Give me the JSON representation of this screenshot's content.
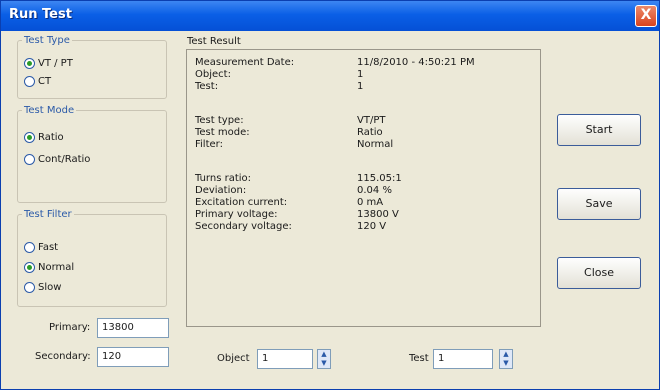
{
  "window": {
    "title": "Run Test",
    "close_glyph": "X"
  },
  "test_type": {
    "legend": "Test Type",
    "options": [
      "VT / PT",
      "CT"
    ],
    "selected": "VT / PT"
  },
  "test_mode": {
    "legend": "Test Mode",
    "options": [
      "Ratio",
      "Cont/Ratio"
    ],
    "selected": "Ratio"
  },
  "test_filter": {
    "legend": "Test Filter",
    "options": [
      "Fast",
      "Normal",
      "Slow"
    ],
    "selected": "Normal"
  },
  "result": {
    "label": "Test Result",
    "rows": [
      {
        "key": "Measurement Date:",
        "value": "11/8/2010 - 4:50:21 PM"
      },
      {
        "key": "Object:",
        "value": "1"
      },
      {
        "key": "Test:",
        "value": "1"
      },
      {
        "key": "Test type:",
        "value": "VT/PT"
      },
      {
        "key": "Test mode:",
        "value": "Ratio"
      },
      {
        "key": "Filter:",
        "value": "Normal"
      },
      {
        "key": "Turns ratio:",
        "value": "115.05:1"
      },
      {
        "key": "Deviation:",
        "value": "0.04 %"
      },
      {
        "key": "Excitation current:",
        "value": "0 mA"
      },
      {
        "key": "Primary voltage:",
        "value": "13800 V"
      },
      {
        "key": "Secondary voltage:",
        "value": "120 V"
      }
    ]
  },
  "buttons": {
    "start": "Start",
    "save": "Save",
    "close": "Close"
  },
  "primary": {
    "label": "Primary:",
    "value": "13800"
  },
  "secondary": {
    "label": "Secondary:",
    "value": "120"
  },
  "object": {
    "label": "Object",
    "value": "1"
  },
  "test": {
    "label": "Test",
    "value": "1"
  },
  "colors": {
    "titlebar": "#0550d6",
    "accent": "#2b5aa8",
    "checked": "#2a9a2a"
  }
}
